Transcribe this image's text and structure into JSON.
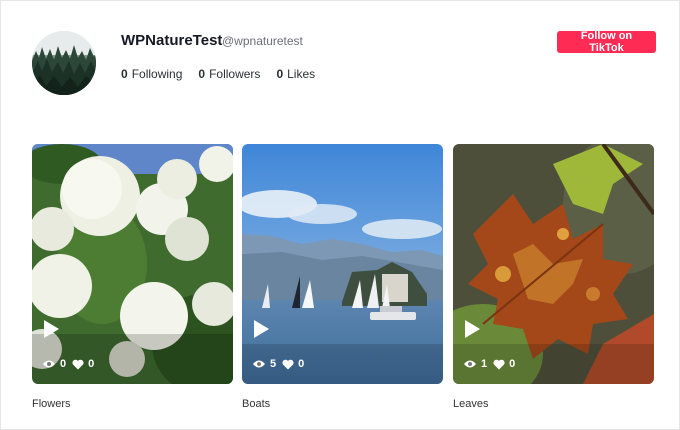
{
  "profile": {
    "name": "WPNatureTest",
    "handle": "@wpnaturetest",
    "stats": [
      {
        "count": "0",
        "label": "Following"
      },
      {
        "count": "0",
        "label": "Followers"
      },
      {
        "count": "0",
        "label": "Likes"
      }
    ],
    "follow_label": "Follow on TikTok"
  },
  "videos": [
    {
      "caption": "Flowers",
      "views": "0",
      "likes": "0"
    },
    {
      "caption": "Boats",
      "views": "5",
      "likes": "0"
    },
    {
      "caption": "Leaves",
      "views": "1",
      "likes": "0"
    }
  ],
  "colors": {
    "accent": "#fe2c55"
  }
}
